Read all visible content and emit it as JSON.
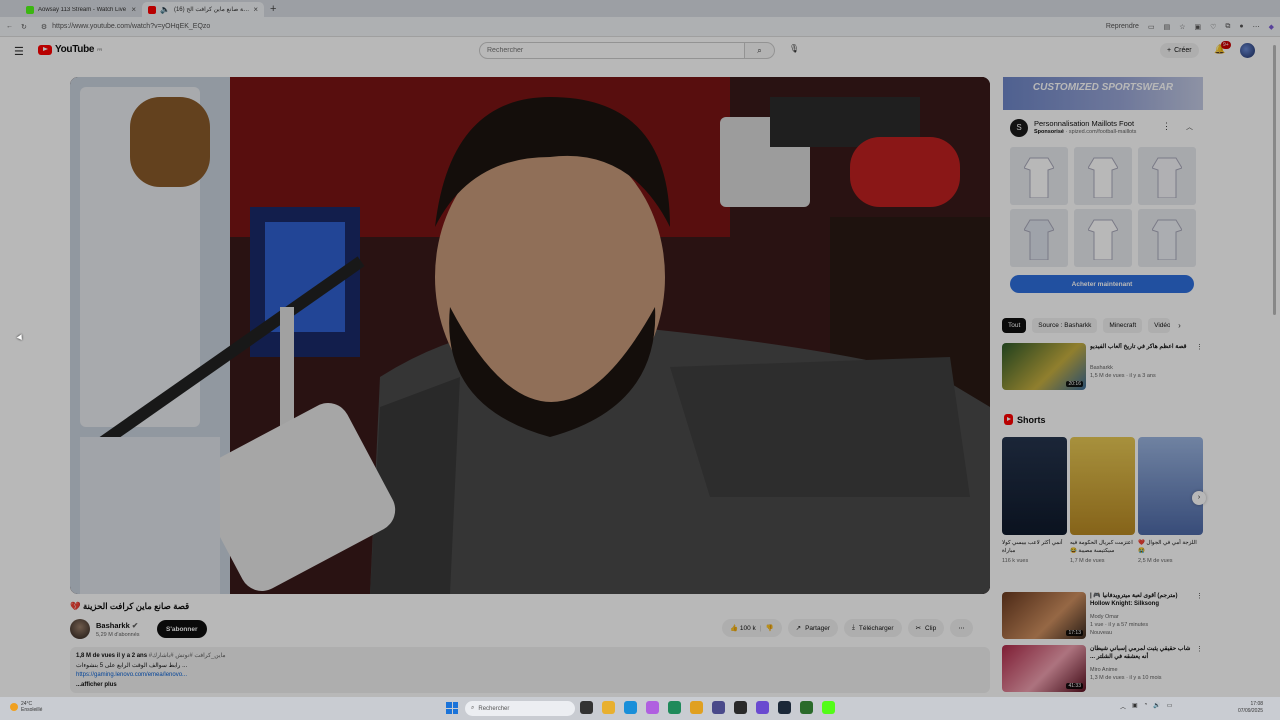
{
  "browser": {
    "tabs": [
      {
        "label": "Aowsay 113 Stream - Watch Live",
        "favicon_color": "#53fc18",
        "active": false
      },
      {
        "label": "(16) قصة صانع ماين كرافت الح",
        "favicon_color": "#ff0000",
        "active": true
      }
    ],
    "new_tab": "+",
    "url": "https://www.youtube.com/watch?v=yOHqEK_EQzo",
    "resume_label": "Reprendre"
  },
  "youtube": {
    "logo_text": "YouTube",
    "logo_region": "FR",
    "search_placeholder": "Rechercher",
    "create_label": "Créer",
    "notif_count": "9+"
  },
  "video": {
    "title": "قصة صانع ماين كرافت الحزينة 💔",
    "channel": "Basharkk",
    "subscribers": "5,29 M d'abonnés",
    "subscribe_label": "S'abonner",
    "likes": "100 k",
    "share_label": "Partager",
    "download_label": "Télécharger",
    "clip_label": "Clip",
    "more_label": "⋯",
    "desc_stats": "1,8 M de vues  il y a 2 ans",
    "desc_tags": "#ماين_كرافت #نوتش #باشارك",
    "desc_line2": "رابط سوالف الوقت الرابع على 5 بنشوءات ...",
    "desc_link": "https://gaming.lenovo.com/emea/lenovo...",
    "desc_more": "...afficher plus"
  },
  "ad": {
    "banner": "CUSTOMIZED SPORTSWEAR",
    "title": "Personnalisation Maillots Foot",
    "sponsored": "Sponsorisé",
    "domain": "spized.com/football-maillots",
    "cta": "Acheter maintenant"
  },
  "chips": [
    "Tout",
    "Source : Basharkk",
    "Minecraft",
    "Vidéos"
  ],
  "recommendations": [
    {
      "title": "قصة اعظم هاكر في تاريخ ألعاب الفيديو",
      "channel": "Basharkk",
      "views": "1,5 M de vues · il y a 3 ans",
      "extra": "",
      "duration": "20:16",
      "thumb_color": "#3a6b2a"
    },
    {
      "title": "(مترجم) أقوى لعبة ميترويدفانيا 🎮 | Hollow Knight: Silksong",
      "channel": "Mody Omar",
      "views": "1 vue · il y a 57 minutes",
      "extra": "Nouveau",
      "duration": "17:13",
      "thumb_color": "#7a4a2a"
    },
    {
      "title": "شاب حقيقي يثبت لمرمي إسباني شيطان أنه يعشقه في الشلتر ...",
      "channel": "Miro Anime",
      "views": "1,3 M de vues · il y a 10 mois",
      "extra": "",
      "duration": "41:33",
      "thumb_color": "#8a1f3a"
    }
  ],
  "shorts": {
    "heading": "Shorts",
    "items": [
      {
        "title": "أنمي أكثر لاعب بيبسي كولا مباراة",
        "views": "116 k vues",
        "thumb_color": "#1d2a3d"
      },
      {
        "title": "اعتزمت كبريال الحكومة فيه سيكتيسة مصيبة 😂",
        "views": "1,7 M de vues",
        "thumb_color": "#d9b23a"
      },
      {
        "title": "اللزجة أمي في الجوال ❤️😭",
        "views": "2,5 M de vues",
        "thumb_color": "#7e9bcf"
      }
    ]
  },
  "taskbar": {
    "temp": "24°C",
    "weather": "Ensoleillé",
    "search": "Rechercher",
    "time": "17:08",
    "date": "07/09/2025"
  }
}
